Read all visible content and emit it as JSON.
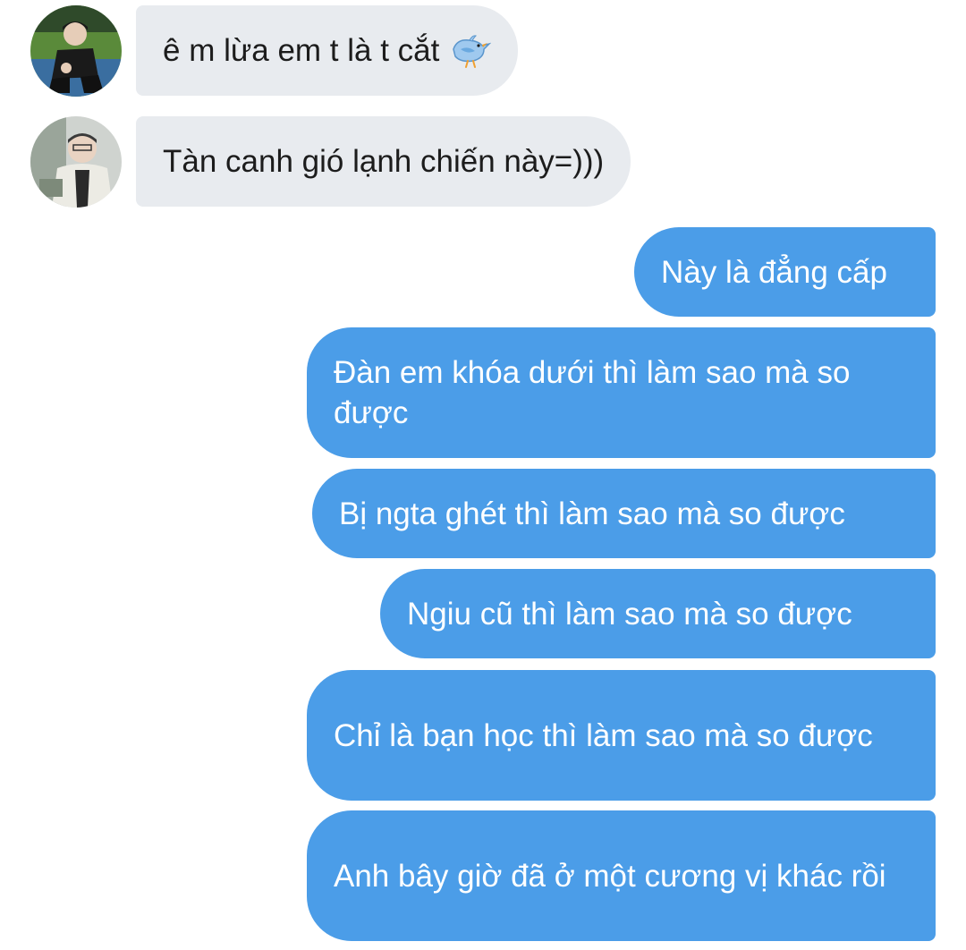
{
  "conversation": {
    "incoming": [
      {
        "text": "ê m lừa em t là t cắt",
        "emoji": "bird-icon"
      },
      {
        "text": "Tàn canh gió lạnh chiến này=)))"
      }
    ],
    "outgoing": [
      {
        "text": "Này là đẳng cấp"
      },
      {
        "text": "Đàn em khóa dưới thì làm sao mà so được"
      },
      {
        "text": "Bị ngta ghét thì làm sao mà so được"
      },
      {
        "text": "Ngiu cũ thì làm sao mà so được"
      },
      {
        "text": "Chỉ là bạn học thì làm sao mà so được"
      },
      {
        "text": "Anh bây giờ đã ở một cương vị khác rồi"
      }
    ]
  },
  "colors": {
    "incoming_bubble": "#e8ebef",
    "outgoing_bubble": "#4b9de8",
    "incoming_text": "#1c1c1c",
    "outgoing_text": "#ffffff"
  }
}
